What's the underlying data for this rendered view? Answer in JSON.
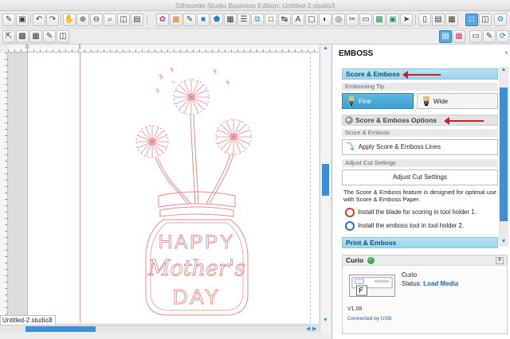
{
  "window": {
    "title": "Silhouette Studio Business Edition: Untitled-2.studio3"
  },
  "ruler": {
    "top_labels": [
      "0",
      "1"
    ]
  },
  "document": {
    "tab_label": "Untitled-2.studio3",
    "tab_close": "×"
  },
  "emboss_panel": {
    "title": "EMBOSS",
    "close_glyph": "×",
    "score_section": {
      "header": "Score & Emboss",
      "embossing_tip_label": "Embossing Tip",
      "tip_fine": "Fine",
      "tip_wide": "Wide",
      "options_label": "Score & Emboss Options",
      "sub_label": "Score & Emboss",
      "apply_button": "Apply Score & Emboss Lines",
      "adjust_label": "Adjust Cut Settings",
      "adjust_button": "Adjust Cut Settings",
      "description": "The Score & Emboss feature is designed for optimal use with Score & Emboss Paper.",
      "instruction_1": "Install the blade for scoring in tool holder 1.",
      "instruction_2": "Install the emboss tool in tool holder 2."
    },
    "print_section": {
      "header": "Print & Emboss"
    },
    "device": {
      "name_header": "Curio",
      "status_ok_glyph": "✓",
      "pause_glyph": "II",
      "device_name": "Curio",
      "status_label": "Status:",
      "status_value": "Load Media",
      "version": "V1.08",
      "connection": "Connected by USB"
    }
  },
  "artwork": {
    "text_line_1": "HAPPY",
    "text_line_2": "Mother's",
    "text_line_3": "DAY"
  },
  "colors": {
    "accent": "#3a8fd8",
    "section_header": "#9dd4ea",
    "artwork_line": "#e58a8a",
    "annotation_arrow": "#cc1f1f"
  },
  "icons": {
    "toolbar_row_1": [
      "new-file-icon",
      "save-icon",
      "undo-icon",
      "redo-icon",
      "pan-icon",
      "zoom-in-icon",
      "zoom-out-icon",
      "zoom-select-icon",
      "zoom-fit-icon",
      "zoom-page-icon",
      "draw-icon",
      "fill-icon",
      "line-color-icon",
      "shape-icon",
      "pentagon-icon",
      "grid-icon",
      "align-icon",
      "replicate-icon",
      "nest-icon",
      "transform-icon",
      "text-icon",
      "trace-icon",
      "modify-icon",
      "offset-icon",
      "knife-icon",
      "eraser-icon",
      "library-icon",
      "store-icon",
      "send-icon",
      "design-view-icon",
      "split-view-icon",
      "settings-icon"
    ],
    "toolbar_row_2": [
      "select-icon",
      "group-icon",
      "ungroup-icon",
      "edit-points-icon",
      "weld-icon",
      "layers-icon",
      "emboss-icon",
      "sketch-icon",
      "cut-icon"
    ]
  }
}
